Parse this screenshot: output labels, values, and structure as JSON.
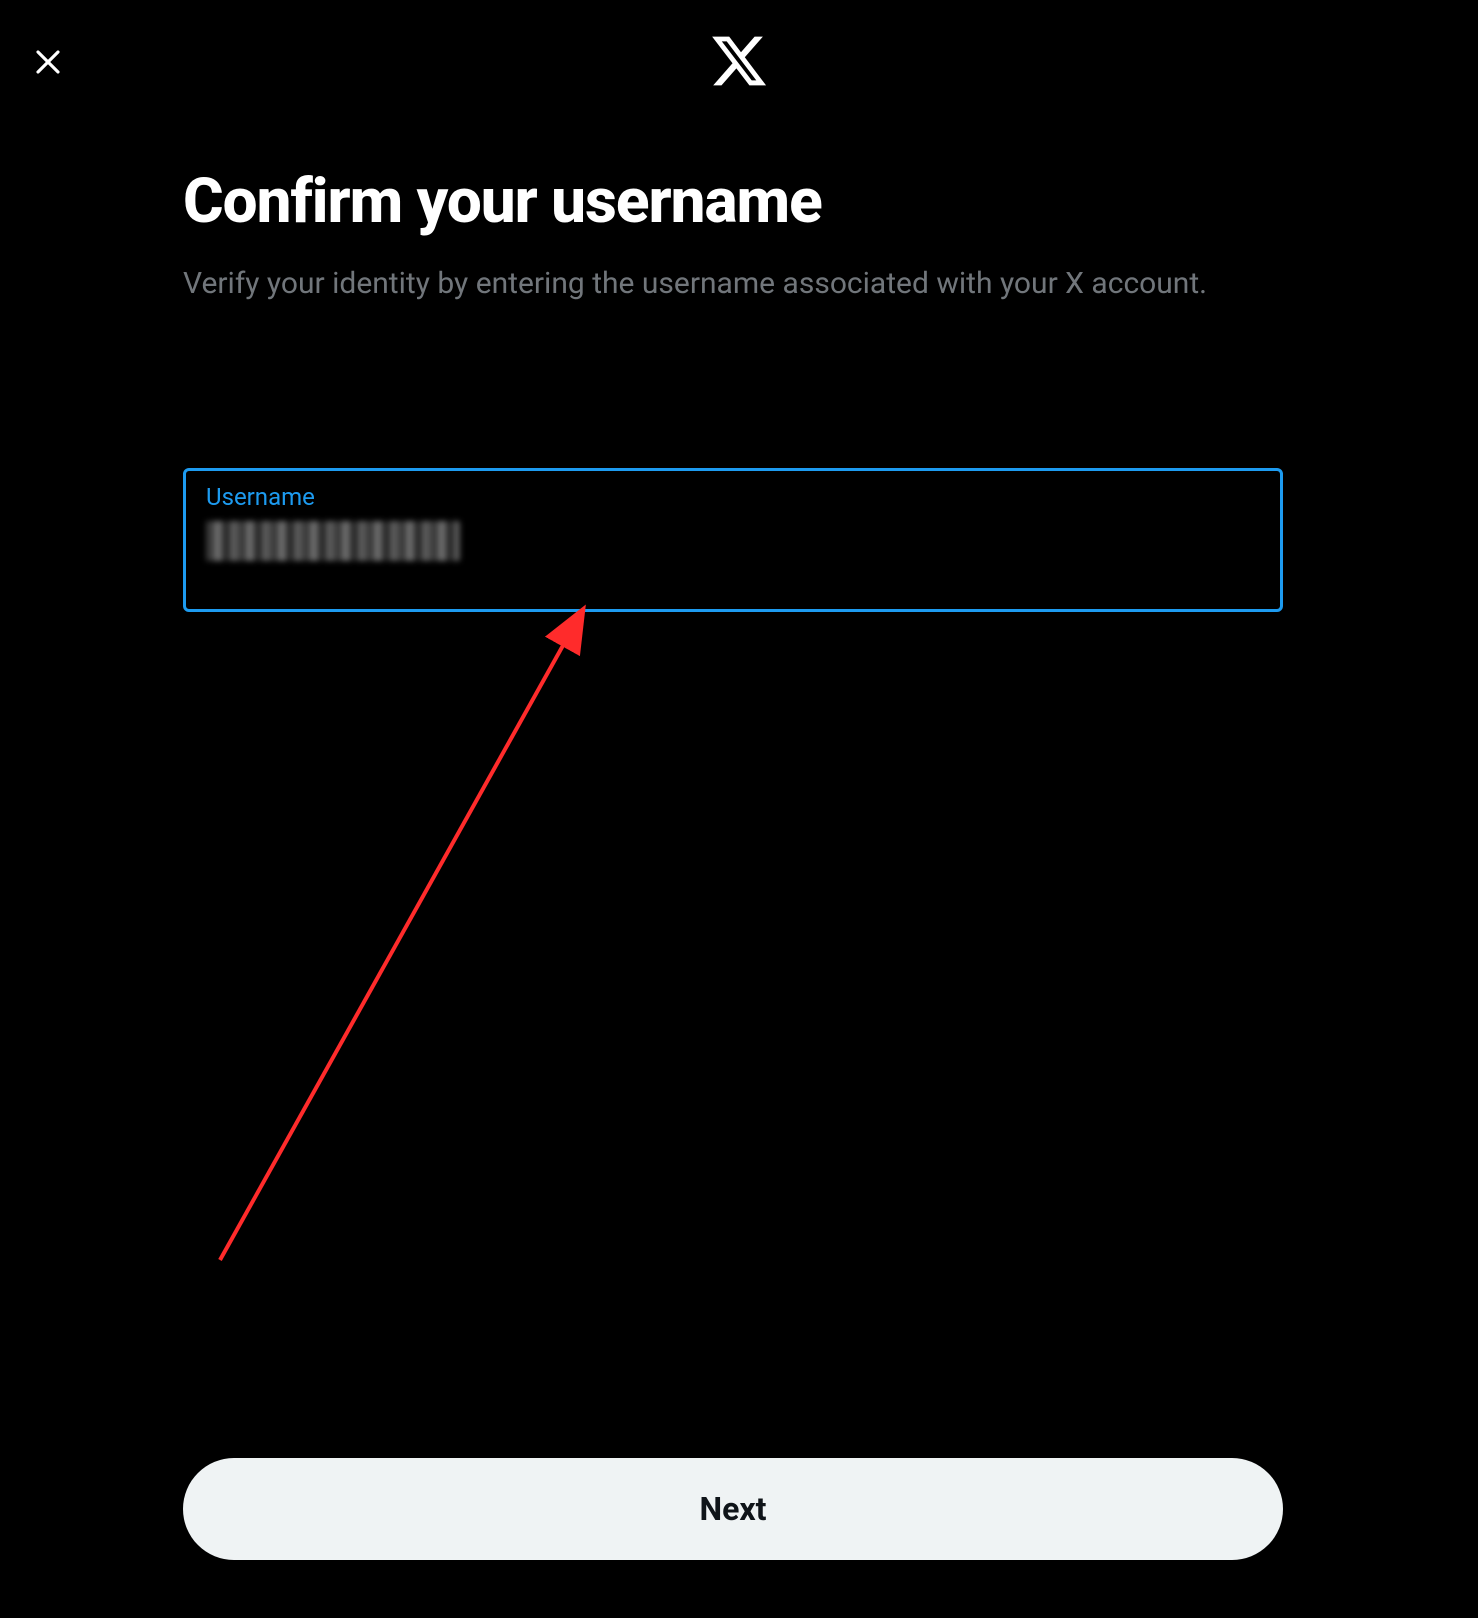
{
  "header": {
    "logo_name": "x-logo"
  },
  "main": {
    "heading": "Confirm your username",
    "subtext": "Verify your identity by entering the username associated with your X account."
  },
  "form": {
    "username_label": "Username",
    "username_value": ""
  },
  "actions": {
    "next_label": "Next"
  },
  "colors": {
    "accent": "#1d9bf0",
    "background": "#000000",
    "text_primary": "#ffffff",
    "text_secondary": "#71767b",
    "button_bg": "#eff3f4",
    "button_text": "#0f1419"
  },
  "annotation": {
    "arrow_color": "#ff2b2b"
  }
}
